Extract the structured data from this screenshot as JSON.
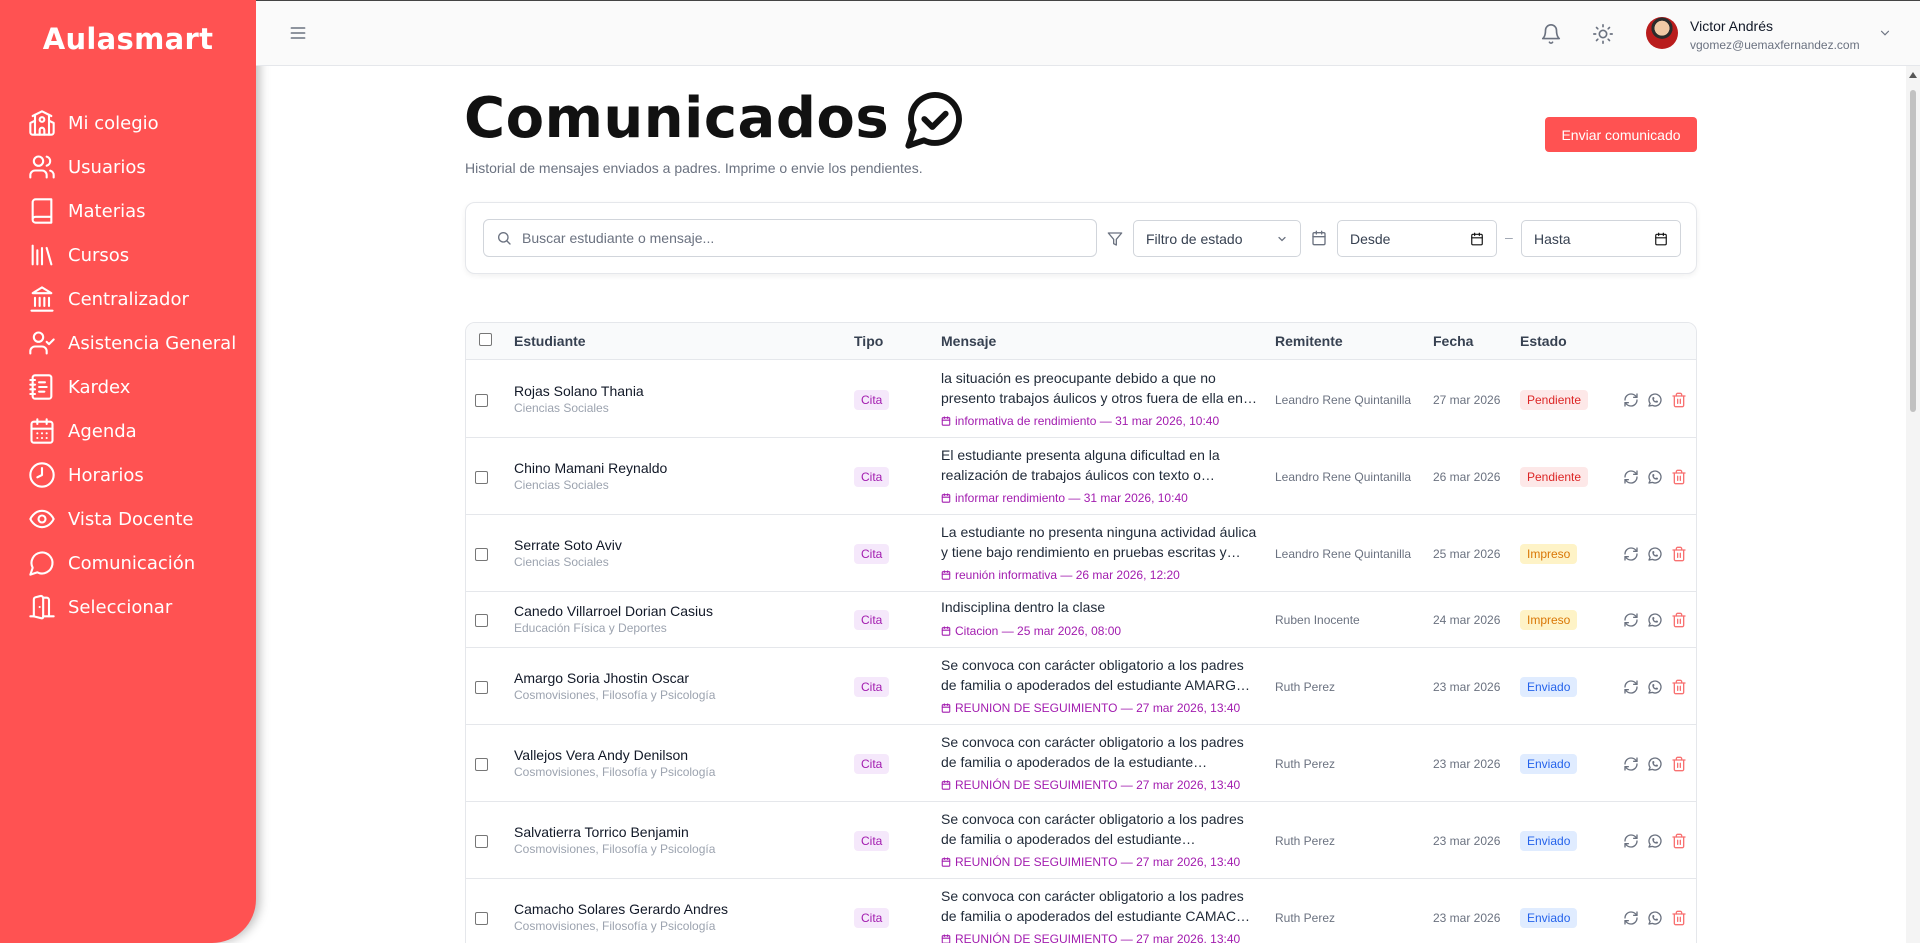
{
  "app": {
    "brand": "Aulasmart"
  },
  "sidebar": {
    "items": [
      {
        "label": "Mi colegio",
        "icon": "school-icon"
      },
      {
        "label": "Usuarios",
        "icon": "users-icon"
      },
      {
        "label": "Materias",
        "icon": "book-icon"
      },
      {
        "label": "Cursos",
        "icon": "library-icon"
      },
      {
        "label": "Centralizador",
        "icon": "landmark-icon"
      },
      {
        "label": "Asistencia General",
        "icon": "user-check-icon"
      },
      {
        "label": "Kardex",
        "icon": "notebook-icon"
      },
      {
        "label": "Agenda",
        "icon": "calendar-icon"
      },
      {
        "label": "Horarios",
        "icon": "clock-icon"
      },
      {
        "label": "Vista Docente",
        "icon": "eye-icon"
      },
      {
        "label": "Comunicación",
        "icon": "message-circle-icon"
      },
      {
        "label": "Seleccionar",
        "icon": "door-icon"
      }
    ]
  },
  "user": {
    "name": "Victor Andrés",
    "email": "vgomez@uemaxfernandez.com"
  },
  "page": {
    "title": "Comunicados",
    "subtitle": "Historial de mensajes enviados a padres. Imprime o envie los pendientes.",
    "send_button": "Enviar comunicado"
  },
  "filters": {
    "search_placeholder": "Buscar estudiante o mensaje...",
    "state_placeholder": "Filtro de estado",
    "from_placeholder": "Desde",
    "to_placeholder": "Hasta",
    "separator": "–"
  },
  "table": {
    "headers": {
      "estudiante": "Estudiante",
      "tipo": "Tipo",
      "mensaje": "Mensaje",
      "remitente": "Remitente",
      "fecha": "Fecha",
      "estado": "Estado"
    },
    "rows": [
      {
        "name": "Rojas Solano Thania",
        "course": "Ciencias Sociales",
        "tipo": "Cita",
        "msg1": "la situación es preocupante debido a que no",
        "msg2": "presento trabajos áulicos y otros fuera de ella en…",
        "event": "informativa de rendimiento — 31 mar 2026, 10:40",
        "remitente": "Leandro Rene Quintanilla",
        "fecha": "27 mar 2026",
        "estado": "Pendiente",
        "estado_kind": "pend"
      },
      {
        "name": "Chino Mamani Reynaldo",
        "course": "Ciencias Sociales",
        "tipo": "Cita",
        "msg1": "El estudiante presenta alguna dificultad en la",
        "msg2": "realización de trabajos áulicos con texto o…",
        "event": "informar rendimiento — 31 mar 2026, 10:40",
        "remitente": "Leandro Rene Quintanilla",
        "fecha": "26 mar 2026",
        "estado": "Pendiente",
        "estado_kind": "pend"
      },
      {
        "name": "Serrate Soto Aviv",
        "course": "Ciencias Sociales",
        "tipo": "Cita",
        "msg1": "La estudiante no presenta ninguna actividad áulica",
        "msg2": "y tiene bajo rendimiento en pruebas escritas y…",
        "event": "reunión informativa — 26 mar 2026, 12:20",
        "remitente": "Leandro Rene Quintanilla",
        "fecha": "25 mar 2026",
        "estado": "Impreso",
        "estado_kind": "imp"
      },
      {
        "name": "Canedo Villarroel Dorian Casius",
        "course": "Educación Física y Deportes",
        "tipo": "Cita",
        "msg1": "Indisciplina dentro la clase",
        "msg2": "",
        "event": "Citacion — 25 mar 2026, 08:00",
        "remitente": "Ruben Inocente",
        "fecha": "24 mar 2026",
        "estado": "Impreso",
        "estado_kind": "imp"
      },
      {
        "name": "Amargo Soria Jhostin Oscar",
        "course": "Cosmovisiones, Filosofía y Psicología",
        "tipo": "Cita",
        "msg1": "Se convoca con carácter obligatorio a los padres",
        "msg2": "de familia o apoderados del estudiante AMARG…",
        "event": "REUNION DE SEGUIMIENTO — 27 mar 2026, 13:40",
        "remitente": "Ruth Perez",
        "fecha": "23 mar 2026",
        "estado": "Enviado",
        "estado_kind": "env"
      },
      {
        "name": "Vallejos Vera Andy Denilson",
        "course": "Cosmovisiones, Filosofía y Psicología",
        "tipo": "Cita",
        "msg1": "Se convoca con carácter obligatorio a los padres",
        "msg2": "de familia o apoderados de la estudiante…",
        "event": "REUNIÓN DE SEGUIMIENTO — 27 mar 2026, 13:40",
        "remitente": "Ruth Perez",
        "fecha": "23 mar 2026",
        "estado": "Enviado",
        "estado_kind": "env"
      },
      {
        "name": "Salvatierra Torrico Benjamin",
        "course": "Cosmovisiones, Filosofía y Psicología",
        "tipo": "Cita",
        "msg1": "Se convoca con carácter obligatorio a los padres",
        "msg2": "de familia o apoderados del estudiante…",
        "event": "REUNIÓN DE SEGUIMIENTO — 27 mar 2026, 13:40",
        "remitente": "Ruth Perez",
        "fecha": "23 mar 2026",
        "estado": "Enviado",
        "estado_kind": "env"
      },
      {
        "name": "Camacho Solares Gerardo Andres",
        "course": "Cosmovisiones, Filosofía y Psicología",
        "tipo": "Cita",
        "msg1": "Se convoca con carácter obligatorio a los padres",
        "msg2": "de familia o apoderados del estudiante CAMAC…",
        "event": "REUNIÓN DE SEGUIMIENTO — 27 mar 2026, 13:40",
        "remitente": "Ruth Perez",
        "fecha": "23 mar 2026",
        "estado": "Enviado",
        "estado_kind": "env"
      }
    ]
  }
}
